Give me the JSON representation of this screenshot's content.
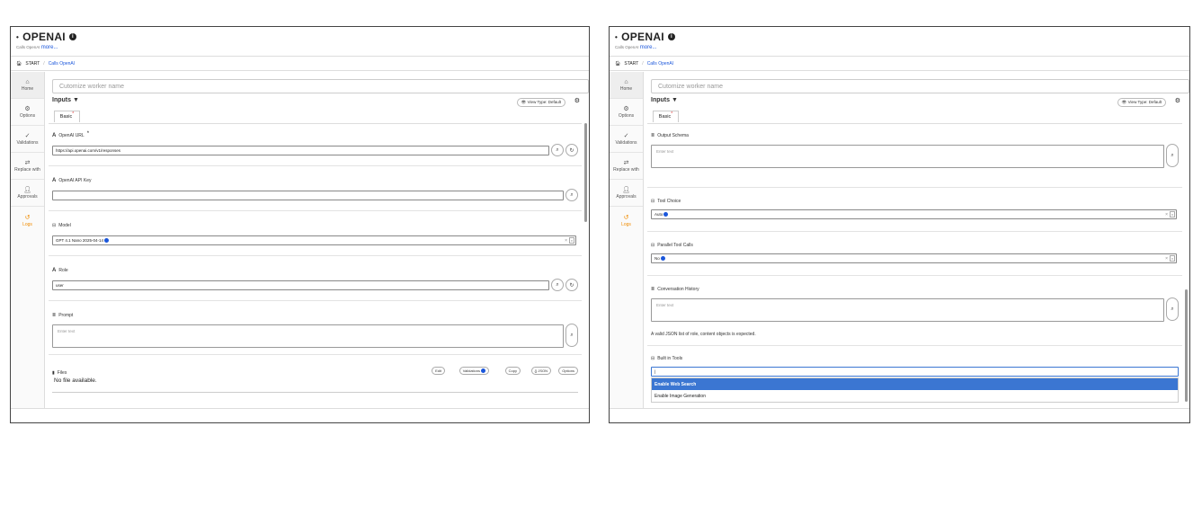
{
  "left": {
    "app_title": "OPENAI",
    "subtitle": "Calls OpenAI",
    "more_link": "more...",
    "breadcrumb": {
      "start": "START",
      "separator": "/",
      "current": "Calls OpenAI"
    },
    "sidebar": [
      {
        "icon": "home-icon",
        "label": "Home"
      },
      {
        "icon": "gear-icon",
        "label": "Options"
      },
      {
        "icon": "validations-icon",
        "label": "Validations"
      },
      {
        "icon": "swap-icon",
        "label": "Replace with"
      },
      {
        "icon": "approvals-icon",
        "label": "Approvals"
      },
      {
        "icon": "logs-icon",
        "label": "Logs"
      }
    ],
    "worker_name_placeholder": "Cutomize worker name",
    "inputs_title": "Inputs",
    "inputs_caret": "▼",
    "view_type_label": "View Type: Default",
    "tab_basic": "Basic",
    "fields": {
      "openai_url": {
        "label": "OpenAI URL",
        "value": "https://api.openai.com/v1/responses"
      },
      "api_key": {
        "label": "OpenAI API Key",
        "value": ""
      },
      "model": {
        "label": "Model",
        "value": "GPT 4.1 Nano 2025-04-14"
      },
      "role": {
        "label": "Role",
        "value": "user"
      },
      "prompt": {
        "label": "Prompt",
        "placeholder": "Enter text"
      },
      "files": {
        "label": "Files",
        "empty_text": "No file available.",
        "buttons": {
          "edit": "Edit",
          "validations": "Validations",
          "copy": "Copy",
          "json": "{} JSON",
          "options": "Options"
        }
      }
    }
  },
  "right": {
    "app_title": "OPENAI",
    "subtitle": "Calls OpenAI",
    "more_link": "more...",
    "breadcrumb": {
      "start": "START",
      "separator": "/",
      "current": "Calls OpenAI"
    },
    "sidebar": [
      {
        "icon": "home-icon",
        "label": "Home"
      },
      {
        "icon": "gear-icon",
        "label": "Options"
      },
      {
        "icon": "validations-icon",
        "label": "Validations"
      },
      {
        "icon": "swap-icon",
        "label": "Replace with"
      },
      {
        "icon": "approvals-icon",
        "label": "Approvals"
      },
      {
        "icon": "logs-icon",
        "label": "Logs"
      }
    ],
    "worker_name_placeholder": "Cutomize worker name",
    "inputs_title": "Inputs",
    "inputs_caret": "▼",
    "view_type_label": "View Type: Default",
    "tab_basic": "Basic",
    "fields": {
      "output_schema": {
        "label": "Output Schema",
        "placeholder": "Enter text"
      },
      "tool_choice": {
        "label": "Tool Choice",
        "value": "Auto"
      },
      "parallel_tool_calls": {
        "label": "Parallel Tool Calls",
        "value": "No"
      },
      "conversation_history": {
        "label": "Conversation History",
        "placeholder": "Enter text",
        "hint": "A valid JSON list of role, content objects is expected."
      },
      "built_in_tools": {
        "label": "Built in Tools",
        "value": "",
        "options": [
          "Enable Web Search",
          "Enable Image Generation"
        ]
      }
    }
  },
  "colors": {
    "accent": "#1a56db",
    "logs": "#f08c00",
    "dropdown_active": "#3b76d2"
  }
}
